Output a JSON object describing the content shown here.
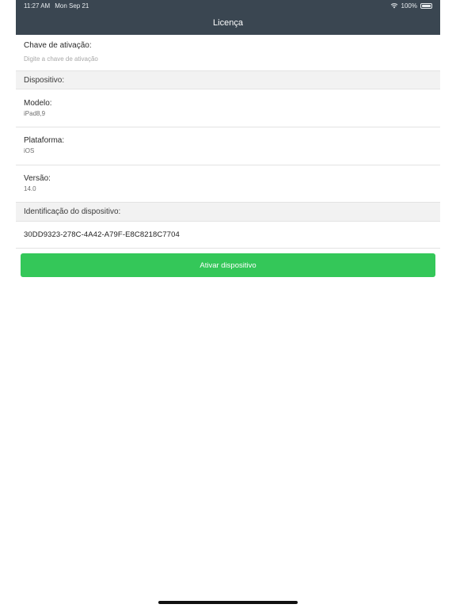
{
  "status_bar": {
    "time": "11:27 AM",
    "date": "Mon Sep 21",
    "battery": "100%",
    "wifi_icon": "wifi-icon",
    "battery_icon": "battery-icon"
  },
  "nav": {
    "title": "Licença"
  },
  "activation": {
    "label": "Chave de ativação:",
    "placeholder": "Digite a chave de ativação"
  },
  "device_section": {
    "title": "Dispositivo:"
  },
  "fields": {
    "model": {
      "label": "Modelo:",
      "value": "iPad8,9"
    },
    "platform": {
      "label": "Plataforma:",
      "value": "iOS"
    },
    "version": {
      "label": "Versão:",
      "value": "14.0"
    }
  },
  "identification": {
    "title": "Identificação do dispositivo:",
    "value": "30DD9323-278C-4A42-A79F-E8C8218C7704"
  },
  "button": {
    "label": "Ativar dispositivo"
  },
  "colors": {
    "nav_background": "#3a4651",
    "button_green": "#34c759",
    "section_background": "#f2f2f2"
  }
}
